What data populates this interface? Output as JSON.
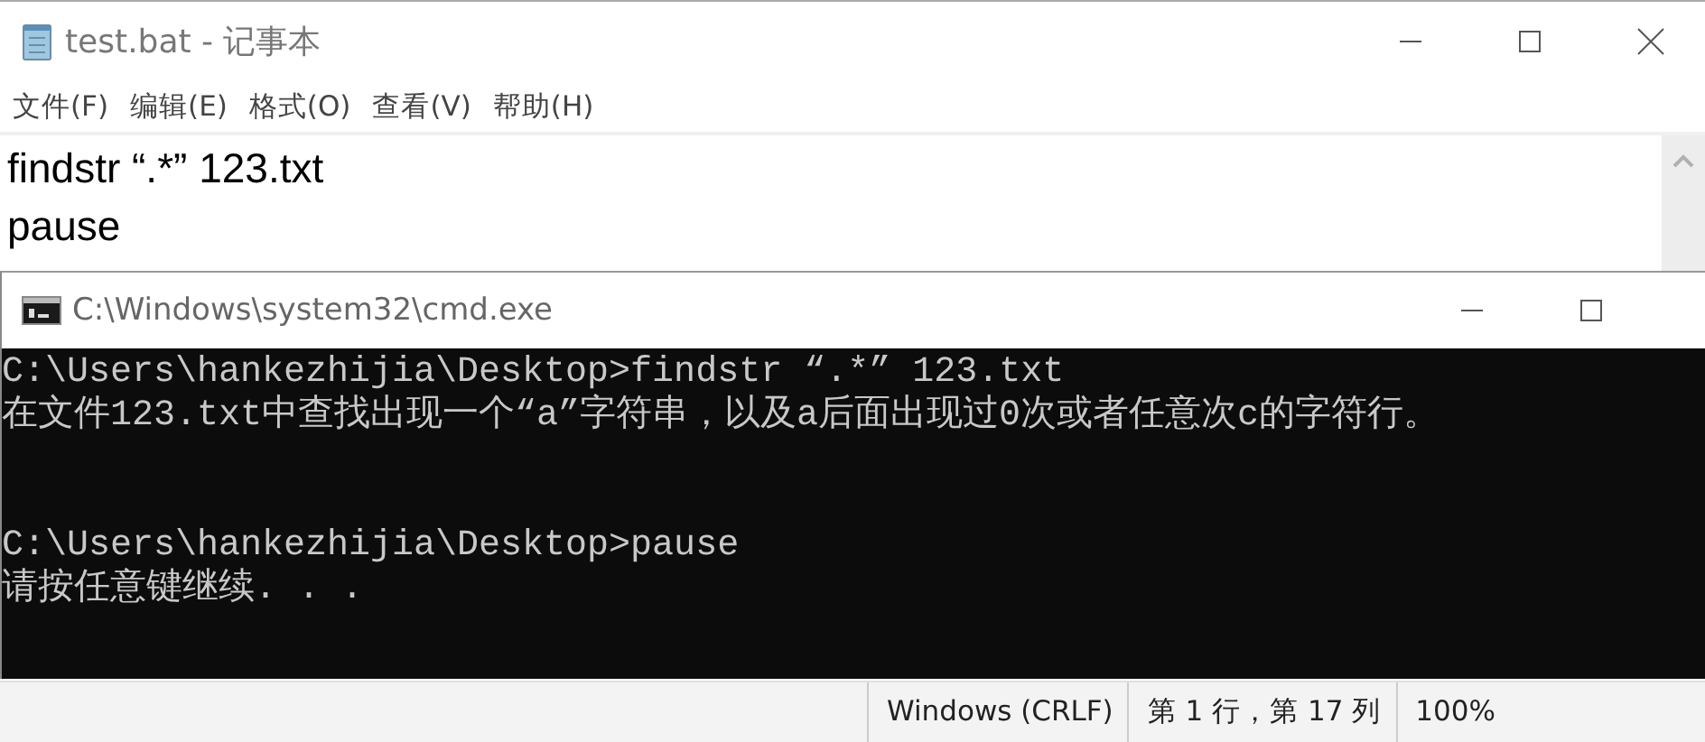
{
  "notepad": {
    "title": "test.bat - 记事本",
    "menu": [
      "文件(F)",
      "编辑(E)",
      "格式(O)",
      "查看(V)",
      "帮助(H)"
    ],
    "content": [
      "findstr “.*” 123.txt",
      "pause"
    ],
    "status_bar": [
      "Windows (CRLF)",
      "第 1 行，第 17 列",
      "100%"
    ]
  },
  "cmd": {
    "title": "C:\\Windows\\system32\\cmd.exe",
    "blocks": [
      [
        "C:\\Users\\hankezhijia\\Desktop>findstr “.*” 123.txt",
        "在文件123.txt中查找出现一个“a”字符串，以及a后面出现过0次或者任意次c的字符行。"
      ],
      [
        "C:\\Users\\hankezhijia\\Desktop>pause",
        "请按任意键继续. . ."
      ]
    ]
  }
}
